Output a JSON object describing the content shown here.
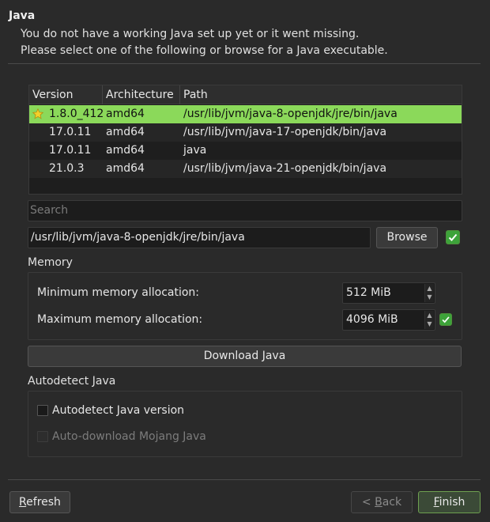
{
  "header": {
    "title": "Java",
    "subtitle_line1": "You do not have a working Java set up yet or it went missing.",
    "subtitle_line2": "Please select one of the following or browse for a Java executable."
  },
  "table": {
    "columns": [
      "Version",
      "Architecture",
      "Path"
    ],
    "rows": [
      {
        "version": "1.8.0_412",
        "arch": "amd64",
        "path": "/usr/lib/jvm/java-8-openjdk/jre/bin/java",
        "selected": true,
        "icon": "star-icon"
      },
      {
        "version": "17.0.11",
        "arch": "amd64",
        "path": "/usr/lib/jvm/java-17-openjdk/bin/java"
      },
      {
        "version": "17.0.11",
        "arch": "amd64",
        "path": "java"
      },
      {
        "version": "21.0.3",
        "arch": "amd64",
        "path": "/usr/lib/jvm/java-21-openjdk/bin/java"
      }
    ],
    "selected_color": "#8bd95a"
  },
  "search": {
    "placeholder": "Search"
  },
  "java_path": {
    "value": "/usr/lib/jvm/java-8-openjdk/jre/bin/java",
    "browse_label": "Browse",
    "valid": true
  },
  "memory": {
    "label": "Memory",
    "min_label": "Minimum memory allocation:",
    "min_value": "512 MiB",
    "max_label": "Maximum memory allocation:",
    "max_value": "4096 MiB",
    "max_valid": true
  },
  "download_label": "Download Java",
  "autodetect": {
    "label": "Autodetect Java",
    "autodetect_version_label": "Autodetect Java version",
    "autodetect_version_checked": false,
    "auto_download_label": "Auto-download Mojang Java",
    "auto_download_enabled": false
  },
  "footer": {
    "refresh_accel": "R",
    "refresh_rest": "efresh",
    "back_prefix": "< ",
    "back_accel": "B",
    "back_rest": "ack",
    "finish_accel": "F",
    "finish_rest": "inish"
  },
  "colors": {
    "accent": "#3da33a",
    "background": "#2a2a2a"
  }
}
